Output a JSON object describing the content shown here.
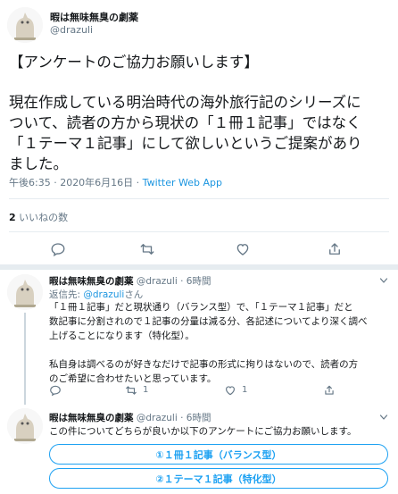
{
  "tweet": {
    "display_name": "暇は無味無臭の劇薬",
    "handle": "@drazuli",
    "line1": "【アンケートのご協力お願いします】",
    "line2": "現在作成している明治時代の海外旅行記のシリーズに",
    "line3": "ついて、読者の方から現状の「１冊１記事」ではなく",
    "line4": "「１テーマ１記事」にして欲しいというご提案があり",
    "line5": "ました。",
    "timestamp": "午後6:35 · 2020年6月16日 · ",
    "app": "Twitter Web App",
    "likes_count": "2",
    "likes_label": "いいねの数"
  },
  "reply1": {
    "display_name": "暇は無味無臭の劇薬",
    "handle": "@drazuli · 6時間",
    "reply_to_label": "返信先: ",
    "reply_to_mention": "@drazuli",
    "reply_to_suffix": "さん",
    "p1_1": "「１冊１記事」だと現状通り（バランス型）で、「１テーマ１記事」だと",
    "p1_2": "数記事に分割されので１記事の分量は減る分、各記述についてより深く調べ",
    "p1_3": "上げることになります（特化型）。",
    "p2_1": "私自身は調べるのが好きなだけで記事の形式に拘りはないので、読者の方",
    "p2_2": "のご希望に合わせたいと思っています。",
    "retweet_count": "1",
    "like_count": "1"
  },
  "reply2": {
    "display_name": "暇は無味無臭の劇薬",
    "handle": "@drazuli · 6時間",
    "text": "この件についてどちらが良いか以下のアンケートにご協力お願いします。",
    "poll_options": [
      "①１冊１記事（バランス型）",
      "②１テーマ１記事（特化型）"
    ]
  },
  "icons": {
    "reply": "reply-icon",
    "retweet": "retweet-icon",
    "like": "heart-icon",
    "share": "share-icon",
    "caret": "chevron-down-icon"
  },
  "colors": {
    "accent": "#1da1f2",
    "link": "#1b95e0",
    "secondary": "#657786",
    "divider": "#e6ecf0"
  }
}
